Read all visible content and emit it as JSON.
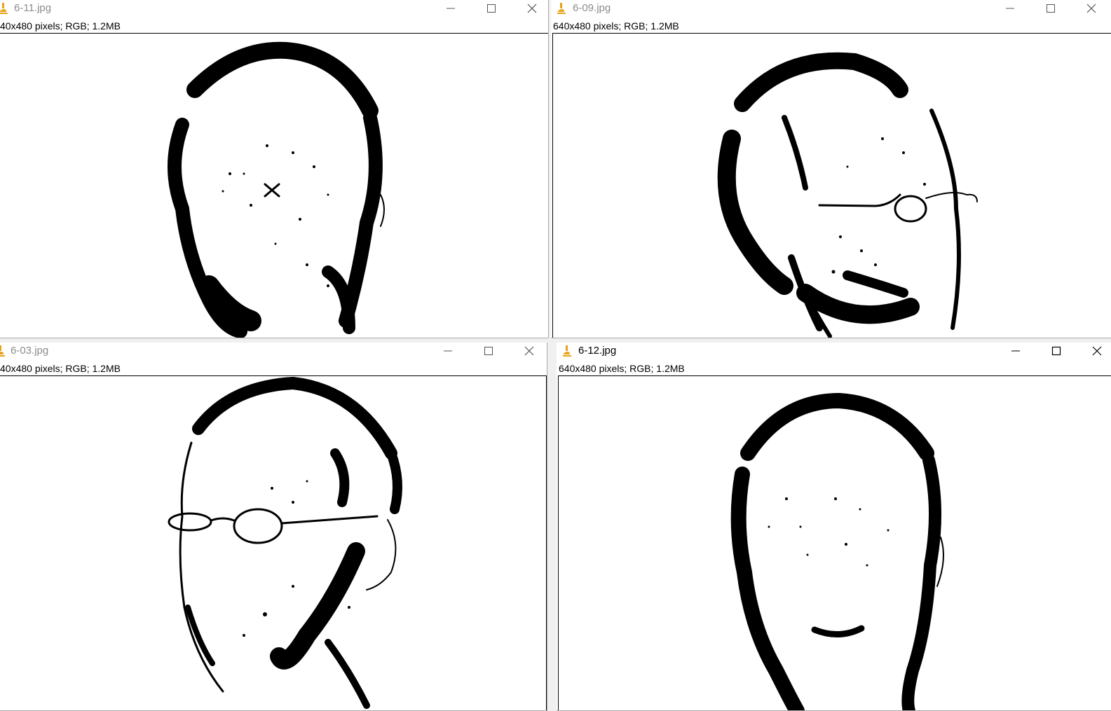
{
  "windows": [
    {
      "title": "6-11.jpg",
      "info": "40x480 pixels; RGB; 1.2MB",
      "state": "inactive"
    },
    {
      "title": "6-09.jpg",
      "info": "640x480 pixels; RGB; 1.2MB",
      "state": "inactive"
    },
    {
      "title": "6-03.jpg",
      "info": "40x480 pixels; RGB; 1.2MB",
      "state": "inactive"
    },
    {
      "title": "6-12.jpg",
      "info": "640x480 pixels; RGB; 1.2MB",
      "state": "active"
    }
  ],
  "icons": {
    "app": "microscope-icon",
    "minimize": "minimize-icon",
    "maximize": "maximize-icon",
    "close": "close-icon"
  },
  "colors": {
    "app_icon": "#e8a317",
    "inactive_title": "#8c8c8c",
    "active_title": "#000000",
    "image_ink": "#000000",
    "image_bg": "#ffffff"
  }
}
